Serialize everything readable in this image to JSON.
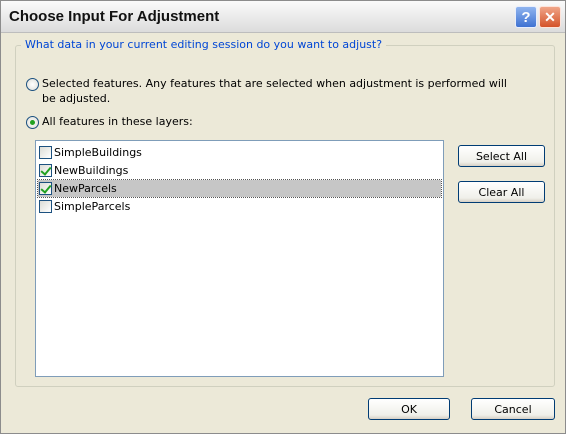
{
  "window": {
    "title": "Choose Input For Adjustment",
    "help_glyph": "?",
    "close_glyph": "✕"
  },
  "group": {
    "legend": "What data in your current editing session do you want to adjust?"
  },
  "options": [
    {
      "line1": "Selected features.  Any features that are selected when adjustment is performed will",
      "line2": "be adjusted.",
      "selected": false
    },
    {
      "line1": "All features in these layers:",
      "selected": true
    }
  ],
  "layers": [
    {
      "name": "SimpleBuildings",
      "checked": false,
      "highlighted": false
    },
    {
      "name": "NewBuildings",
      "checked": true,
      "highlighted": false
    },
    {
      "name": "NewParcels",
      "checked": true,
      "highlighted": true
    },
    {
      "name": "SimpleParcels",
      "checked": false,
      "highlighted": false
    }
  ],
  "buttons": {
    "select_all": "Select All",
    "clear_all": "Clear All",
    "ok": "OK",
    "cancel": "Cancel"
  },
  "colors": {
    "legend_text": "#0046d5",
    "check_mark": "#21a121",
    "dialog_bg": "#ece9d8"
  }
}
